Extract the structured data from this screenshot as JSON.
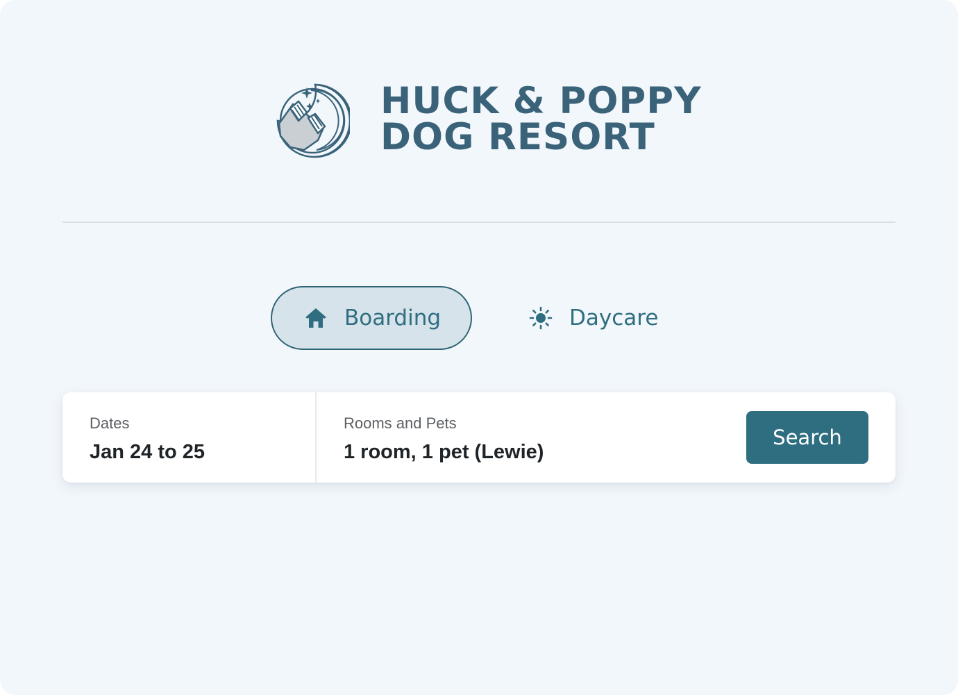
{
  "brand": {
    "line1": "HUCK & POPPY",
    "line2": "DOG RESORT",
    "logo_icon": "moon-dog-logo-icon",
    "color": "#3a637a"
  },
  "tabs": [
    {
      "label": "Boarding",
      "icon": "house-icon",
      "selected": true
    },
    {
      "label": "Daycare",
      "icon": "sun-icon",
      "selected": false
    }
  ],
  "search": {
    "dates": {
      "label": "Dates",
      "value": "Jan 24 to 25"
    },
    "rooms": {
      "label": "Rooms and Pets",
      "value": "1 room, 1 pet (Lewie)"
    },
    "button_label": "Search"
  },
  "colors": {
    "accent": "#2e6e80",
    "background": "#f2f7fb",
    "selected_tab_bg": "#d6e3eb"
  }
}
